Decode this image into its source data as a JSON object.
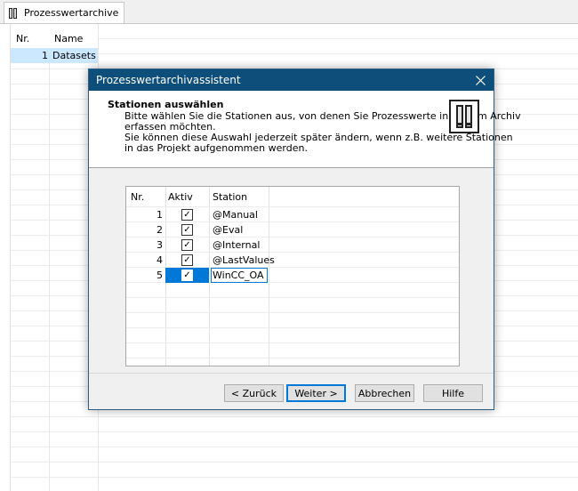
{
  "window": {
    "tab_label": "Prozesswertarchive",
    "tab_icon": "archive-icon"
  },
  "archive_list": {
    "columns": [
      "Nr.",
      "Name"
    ],
    "rows": [
      {
        "nr": "1",
        "name": "Datasets"
      }
    ]
  },
  "dialog": {
    "title": "Prozesswertarchivassistent",
    "close_icon": "close-icon",
    "heading": "Stationen auswählen",
    "description_lines": [
      "Bitte wählen Sie die Stationen aus, von denen Sie Prozesswerte in diesem Archiv",
      "erfassen möchten.",
      "Sie können diese Auswahl jederzeit später ändern, wenn z.B. weitere Stationen",
      "in das Projekt aufgenommen werden."
    ],
    "wizard_icon": "archive-icon",
    "table": {
      "columns": [
        "Nr.",
        "Aktiv",
        "Station"
      ],
      "rows": [
        {
          "nr": "1",
          "active": true,
          "station": "@Manual"
        },
        {
          "nr": "2",
          "active": true,
          "station": "@Eval"
        },
        {
          "nr": "3",
          "active": true,
          "station": "@Internal"
        },
        {
          "nr": "4",
          "active": true,
          "station": "@LastValues"
        },
        {
          "nr": "5",
          "active": true,
          "station": "WinCC_OA"
        }
      ],
      "selected_row": "5",
      "check_glyph": "✓"
    },
    "buttons": {
      "back": "< Zurück",
      "next": "Weiter >",
      "cancel": "Abbrechen",
      "help": "Hilfe"
    }
  },
  "colors": {
    "titlebar": "#0e4e7a",
    "selection": "#0078d7",
    "list_selection": "#cce8ff"
  }
}
